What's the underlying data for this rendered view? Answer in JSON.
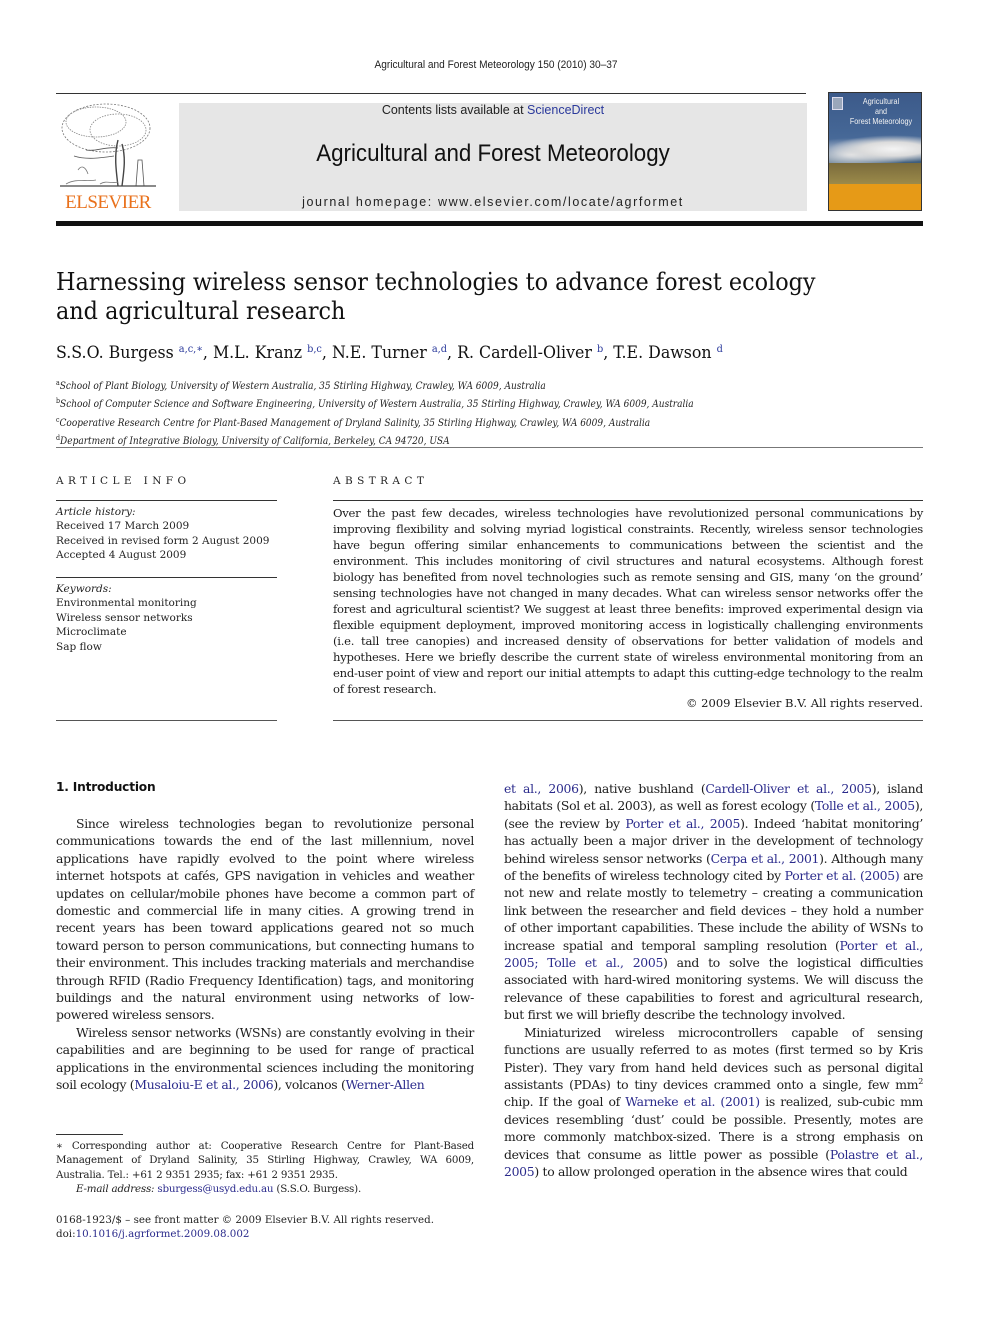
{
  "running_head": "Agricultural and Forest Meteorology 150 (2010) 30–37",
  "header": {
    "publisher_logo": "tree-logo",
    "publisher_name": "ELSEVIER",
    "contents_prefix": "Contents lists available at ",
    "contents_link": "ScienceDirect",
    "journal_title": "Agricultural and Forest Meteorology",
    "homepage": "journal homepage: www.elsevier.com/locate/agrformet",
    "cover_title_line1": "Agricultural",
    "cover_title_line2": "and",
    "cover_title_line3": "Forest Meteorology",
    "colors": {
      "publisher_orange": "#e9711c",
      "banner_gray": "#e6e6e6",
      "link_blue": "#2b3a9c",
      "cover_band": "#e69a17"
    }
  },
  "article": {
    "title": "Harnessing wireless sensor technologies to advance forest ecology and agricultural research",
    "authors": [
      {
        "name": "S.S.O. Burgess",
        "sup": "a,c,∗"
      },
      {
        "name": "M.L. Kranz",
        "sup": "b,c"
      },
      {
        "name": "N.E. Turner",
        "sup": "a,d"
      },
      {
        "name": "R. Cardell-Oliver",
        "sup": "b"
      },
      {
        "name": "T.E. Dawson",
        "sup": "d"
      }
    ],
    "affiliations": [
      {
        "key": "a",
        "text": "School of Plant Biology, University of Western Australia, 35 Stirling Highway, Crawley, WA 6009, Australia"
      },
      {
        "key": "b",
        "text": "School of Computer Science and Software Engineering, University of Western Australia, 35 Stirling Highway, Crawley, WA 6009, Australia"
      },
      {
        "key": "c",
        "text": "Cooperative Research Centre for Plant-Based Management of Dryland Salinity, 35 Stirling Highway, Crawley, WA 6009, Australia"
      },
      {
        "key": "d",
        "text": "Department of Integrative Biology, University of California, Berkeley, CA 94720, USA"
      }
    ]
  },
  "article_info": {
    "heading": "ARTICLE INFO",
    "history_label": "Article history:",
    "history": [
      "Received 17 March 2009",
      "Received in revised form 2 August 2009",
      "Accepted 4 August 2009"
    ],
    "keywords_label": "Keywords:",
    "keywords": [
      "Environmental monitoring",
      "Wireless sensor networks",
      "Microclimate",
      "Sap flow"
    ]
  },
  "abstract": {
    "heading": "ABSTRACT",
    "text": "Over the past few decades, wireless technologies have revolutionized personal communications by improving flexibility and solving myriad logistical constraints. Recently, wireless sensor technologies have begun offering similar enhancements to communications between the scientist and the environment. This includes monitoring of civil structures and natural ecosystems. Although forest biology has benefited from novel technologies such as remote sensing and GIS, many ‘on the ground’ sensing technologies have not changed in many decades. What can wireless sensor networks offer the forest and agricultural scientist? We suggest at least three benefits: improved experimental design via flexible equipment deployment, improved monitoring access in logistically challenging environments (i.e. tall tree canopies) and increased density of observations for better validation of models and hypotheses. Here we briefly describe the current state of wireless environmental monitoring from an end-user point of view and report our initial attempts to adapt this cutting-edge technology to the realm of forest research.",
    "copyright": "© 2009 Elsevier B.V. All rights reserved."
  },
  "body": {
    "section_heading": "1.  Introduction",
    "left": {
      "p1": "Since wireless technologies began to revolutionize personal communications towards the end of the last millennium, novel applications have rapidly evolved to the point where wireless internet hotspots at cafés, GPS navigation in vehicles and weather updates on cellular/mobile phones have become a common part of domestic and commercial life in many cities. A growing trend in recent years has been toward applications geared not so much toward person to person communications, but connecting humans to their environment. This includes tracking materials and merchandise through RFID (Radio Frequency Identification) tags, and monitoring buildings and the natural environment using networks of low-powered wireless sensors.",
      "p2_a": "Wireless sensor networks (WSNs) are constantly evolving in their capabilities and are beginning to be used for range of practical applications in the environmental sciences including the monitoring soil ecology (",
      "p2_ref1": "Musaloiu-E et al., 2006",
      "p2_b": "), volcanos (",
      "p2_ref2": "Werner-Allen"
    },
    "right": {
      "c_ref1": "et al., 2006",
      "c_a": "), native bushland (",
      "c_ref2": "Cardell-Oliver et al., 2005",
      "c_b": "), island habitats (Sol et al. 2003), as well as forest ecology (",
      "c_ref3": "Tolle et al., 2005",
      "c_c": "), (see the review by ",
      "c_ref4": "Porter et al., 2005",
      "c_d": "). Indeed ‘habitat monitoring’ has actually been a major driver in the development of technology behind wireless sensor networks (",
      "c_ref5": "Cerpa et al., 2001",
      "c_e": "). Although many of the benefits of wireless technology cited by ",
      "c_ref6": "Porter et al. (2005)",
      "c_f": " are not new and relate mostly to telemetry – creating a communication link between the researcher and field devices – they hold a number of other important capabilities. These include the ability of WSNs to increase spatial and temporal sampling resolution (",
      "c_ref7": "Porter et al., 2005; Tolle et al., 2005",
      "c_g": ") and to solve the logistical difficulties associated with hard-wired monitoring systems. We will discuss the relevance of these capabilities to forest and agricultural research, but first we will briefly describe the technology involved.",
      "p2_a": "Miniaturized wireless microcontrollers capable of sensing functions are usually referred to as motes (first termed so by Kris Pister). They vary from hand held devices such as personal digital assistants (PDAs) to tiny devices crammed onto a single, few mm",
      "p2_sup": "2",
      "p2_b": " chip. If the goal of ",
      "p2_ref1": "Warneke et al. (2001)",
      "p2_c": " is realized, sub-cubic mm devices resembling ‘dust’ could be possible. Presently, motes are more commonly matchbox-sized. There is a strong emphasis on devices that consume as little power as possible (",
      "p2_ref2": "Polastre et al., 2005",
      "p2_d": ") to allow prolonged operation in the absence wires that could"
    }
  },
  "footnotes": {
    "corresponding": "∗ Corresponding author at: Cooperative Research Centre for Plant-Based Management of Dryland Salinity, 35 Stirling Highway, Crawley, WA 6009, Australia. Tel.: +61 2 9351 2935; fax: +61 2 9351 2935.",
    "email_label": "E-mail address: ",
    "email": "sburgess@usyd.edu.au",
    "email_suffix": " (S.S.O. Burgess).",
    "issn_line": "0168-1923/$ – see front matter © 2009 Elsevier B.V. All rights reserved.",
    "doi_prefix": "doi:",
    "doi": "10.1016/j.agrformet.2009.08.002"
  }
}
